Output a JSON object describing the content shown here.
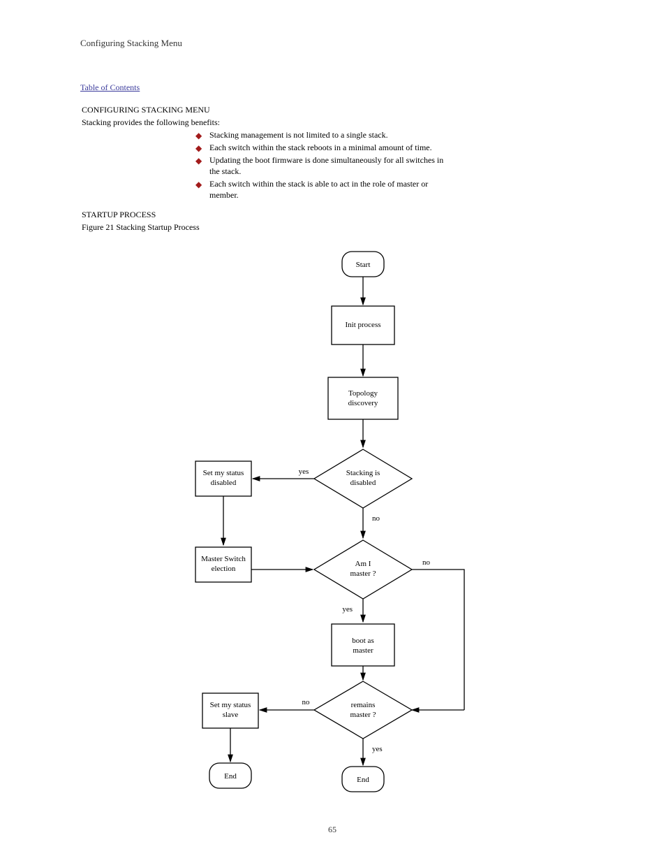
{
  "page": {
    "header": "Configuring Stacking Menu",
    "toc_link": "Table of Contents",
    "section_title": "CONFIGURING STACKING MENU",
    "intro": "Stacking provides the following benefits:",
    "bullets": {
      "b1": "Stacking management is not limited to a single stack.",
      "b2": "Each switch within the stack reboots in a minimal amount of time.",
      "b3_l1": "Updating the boot firmware is done simultaneously for all switches in",
      "b3_l2": "the stack.",
      "b4_l1": "Each switch within the stack is able to act in the role of master or",
      "b4_l2": "member."
    },
    "flow_section_title": "STARTUP PROCESS",
    "fig_caption": "Figure 21  Stacking Startup Process",
    "page_number": "65"
  },
  "diagram": {
    "nodes": {
      "start": "Start",
      "init": "Init process",
      "discovery": "Topology discovery",
      "d_disabled": "Stacking is disabled",
      "set_disabled": "Set my status disabled",
      "elect": "Master Switch election",
      "d_master": "Am I master ?",
      "set_slave": "Set my status slave",
      "boot_master": "boot as master",
      "d_remains": "remains master ?",
      "end_slave": "End",
      "end_master": "End"
    },
    "edge_labels": {
      "yes": "yes",
      "no": "no"
    }
  }
}
